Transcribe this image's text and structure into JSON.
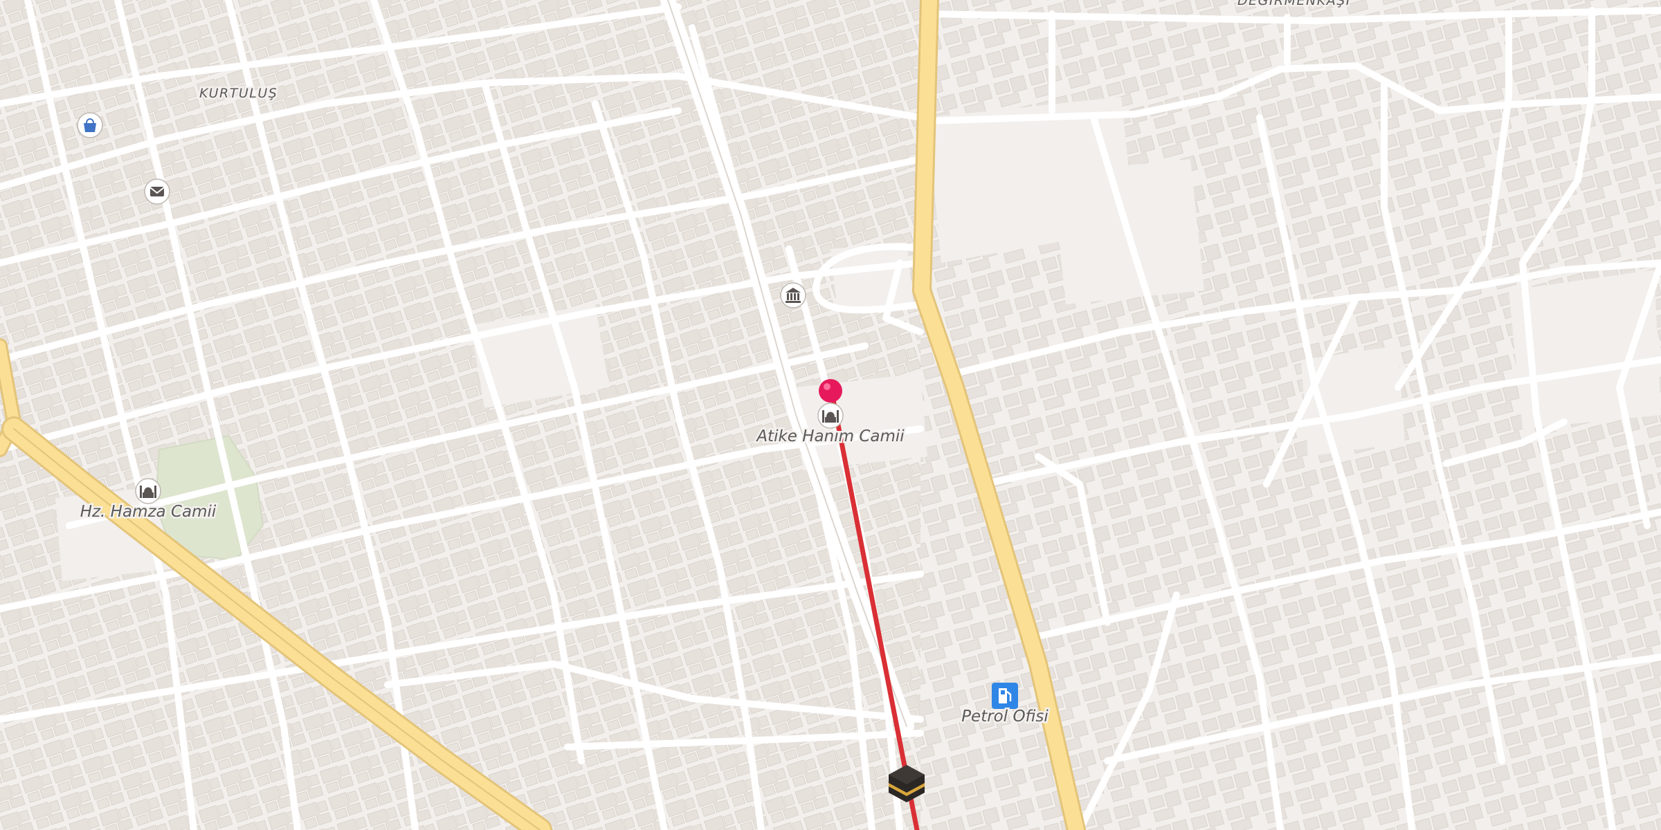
{
  "map": {
    "area_labels": {
      "kurtulus": "KURTULUŞ",
      "degirmenkasi": "DEĞİRMENKAŞI"
    },
    "poi_labels": {
      "atike_hanim_camii": "Atike Hanım Camii",
      "hz_hamza_camii": "Hz. Hamza Camii",
      "petrol_ofisi": "Petrol Ofisi"
    },
    "icons": {
      "shop": "shopping-bag-icon",
      "post": "envelope-icon",
      "museum": "museum-icon",
      "mosque": "mosque-icon",
      "fuel": "fuel-pump-icon",
      "kaaba": "kaaba-icon",
      "pin": "location-pin-icon"
    },
    "colors": {
      "background": "#f2efec",
      "building": "#e7e1dc",
      "road": "#ffffff",
      "main_road": "#fbdf95",
      "park": "#dfe6d1",
      "route": "#d92f35",
      "pin": "#e6195c",
      "fuel": "#2f86e6"
    }
  }
}
